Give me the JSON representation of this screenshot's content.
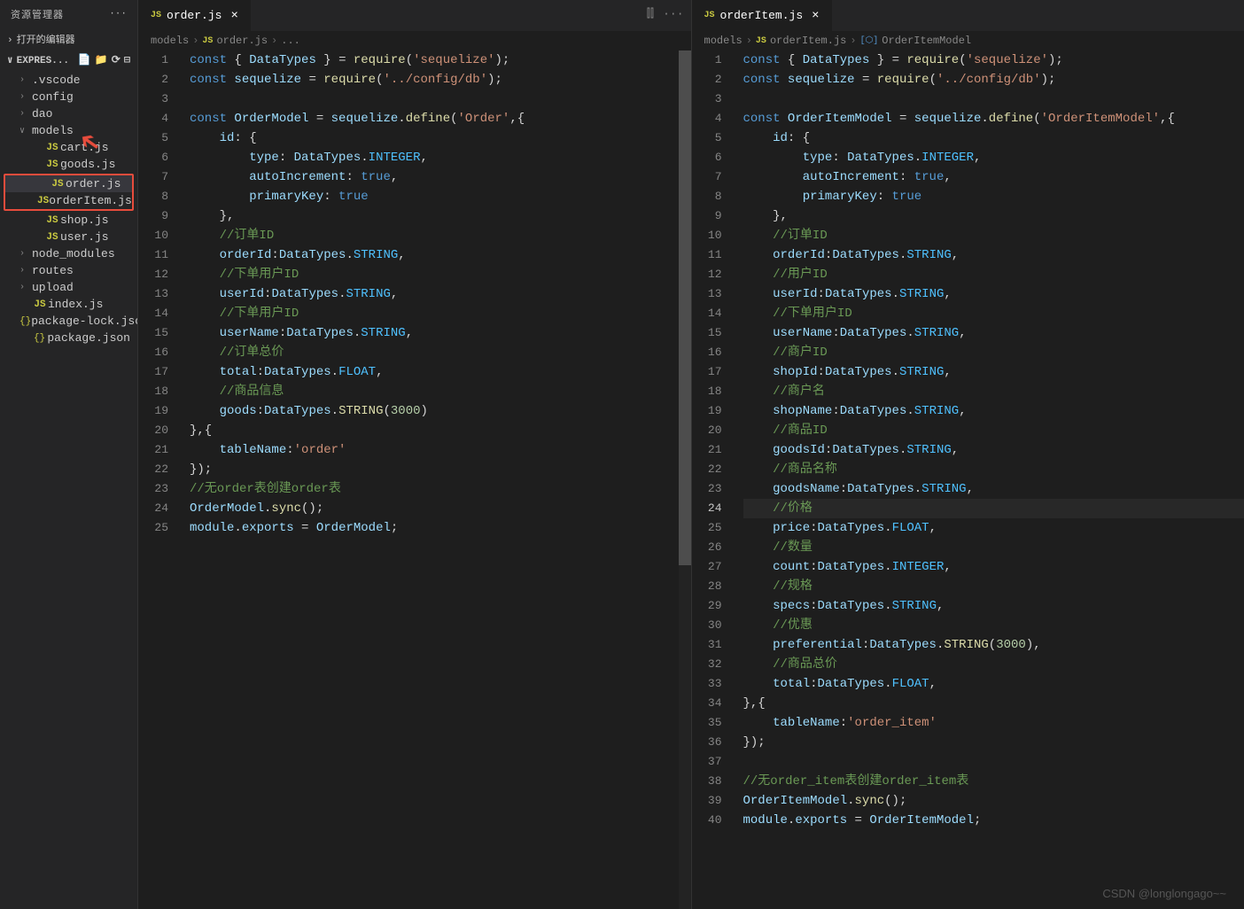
{
  "sidebar": {
    "title": "资源管理器",
    "open_editors": "打开的编辑器",
    "project": "EXPRES...",
    "items": [
      {
        "type": "folder",
        "name": ".vscode",
        "open": false,
        "indent": 1
      },
      {
        "type": "folder",
        "name": "config",
        "open": false,
        "indent": 1
      },
      {
        "type": "folder",
        "name": "dao",
        "open": false,
        "indent": 1
      },
      {
        "type": "folder",
        "name": "models",
        "open": true,
        "indent": 1
      },
      {
        "type": "js",
        "name": "cart.js",
        "indent": 2
      },
      {
        "type": "js",
        "name": "goods.js",
        "indent": 2
      },
      {
        "type": "js",
        "name": "order.js",
        "indent": 2,
        "active": true,
        "boxed": true
      },
      {
        "type": "js",
        "name": "orderItem.js",
        "indent": 2,
        "boxed": true
      },
      {
        "type": "js",
        "name": "shop.js",
        "indent": 2
      },
      {
        "type": "js",
        "name": "user.js",
        "indent": 2
      },
      {
        "type": "folder",
        "name": "node_modules",
        "open": false,
        "indent": 1
      },
      {
        "type": "folder",
        "name": "routes",
        "open": false,
        "indent": 1
      },
      {
        "type": "folder",
        "name": "upload",
        "open": false,
        "indent": 1
      },
      {
        "type": "js",
        "name": "index.js",
        "indent": 1
      },
      {
        "type": "json",
        "name": "package-lock.json",
        "indent": 1
      },
      {
        "type": "json",
        "name": "package.json",
        "indent": 1
      }
    ]
  },
  "editor_left": {
    "tab": "order.js",
    "breadcrumb": [
      "models",
      "order.js",
      "..."
    ],
    "lines": [
      "<span class='kw'>const</span> <span class='pun'>{ </span><span class='var'>DataTypes</span><span class='pun'> } = </span><span class='fn'>require</span><span class='pun'>(</span><span class='str'>'sequelize'</span><span class='pun'>);</span>",
      "<span class='kw'>const</span> <span class='var'>sequelize</span> <span class='pun'>= </span><span class='fn'>require</span><span class='pun'>(</span><span class='str'>'../config/db'</span><span class='pun'>);</span>",
      "",
      "<span class='kw'>const</span> <span class='var'>OrderModel</span> <span class='pun'>= </span><span class='var'>sequelize</span><span class='pun'>.</span><span class='fn'>define</span><span class='pun'>(</span><span class='str'>'Order'</span><span class='pun'>,{</span>",
      "    <span class='var'>id</span><span class='pun'>: {</span>",
      "        <span class='var'>type</span><span class='pun'>: </span><span class='var'>DataTypes</span><span class='pun'>.</span><span class='const'>INTEGER</span><span class='pun'>,</span>",
      "        <span class='var'>autoIncrement</span><span class='pun'>: </span><span class='kw'>true</span><span class='pun'>,</span>",
      "        <span class='var'>primaryKey</span><span class='pun'>: </span><span class='kw'>true</span>",
      "    <span class='pun'>},</span>",
      "    <span class='com'>//订单ID</span>",
      "    <span class='var'>orderId</span><span class='pun'>:</span><span class='var'>DataTypes</span><span class='pun'>.</span><span class='const'>STRING</span><span class='pun'>,</span>",
      "    <span class='com'>//下单用户ID</span>",
      "    <span class='var'>userId</span><span class='pun'>:</span><span class='var'>DataTypes</span><span class='pun'>.</span><span class='const'>STRING</span><span class='pun'>,</span>",
      "    <span class='com'>//下单用户ID</span>",
      "    <span class='var'>userName</span><span class='pun'>:</span><span class='var'>DataTypes</span><span class='pun'>.</span><span class='const'>STRING</span><span class='pun'>,</span>",
      "    <span class='com'>//订单总价</span>",
      "    <span class='var'>total</span><span class='pun'>:</span><span class='var'>DataTypes</span><span class='pun'>.</span><span class='const'>FLOAT</span><span class='pun'>,</span>",
      "    <span class='com'>//商品信息</span>",
      "    <span class='var'>goods</span><span class='pun'>:</span><span class='var'>DataTypes</span><span class='pun'>.</span><span class='fn'>STRING</span><span class='pun'>(</span><span class='num'>3000</span><span class='pun'>)</span>",
      "<span class='pun'>},{</span>",
      "    <span class='var'>tableName</span><span class='pun'>:</span><span class='str'>'order'</span>",
      "<span class='pun'>});</span>",
      "<span class='com'>//无order表创建order表</span>",
      "<span class='var'>OrderModel</span><span class='pun'>.</span><span class='fn'>sync</span><span class='pun'>();</span>",
      "<span class='var'>module</span><span class='pun'>.</span><span class='var'>exports</span> <span class='pun'>= </span><span class='var'>OrderModel</span><span class='pun'>;</span>"
    ]
  },
  "editor_right": {
    "tab": "orderItem.js",
    "breadcrumb": [
      "models",
      "orderItem.js",
      "OrderItemModel"
    ],
    "lines": [
      "<span class='kw'>const</span> <span class='pun'>{ </span><span class='var'>DataTypes</span><span class='pun'> } = </span><span class='fn'>require</span><span class='pun'>(</span><span class='str'>'sequelize'</span><span class='pun'>);</span>",
      "<span class='kw'>const</span> <span class='var'>sequelize</span> <span class='pun'>= </span><span class='fn'>require</span><span class='pun'>(</span><span class='str'>'../config/db'</span><span class='pun'>);</span>",
      "",
      "<span class='kw'>const</span> <span class='var'>OrderItemModel</span> <span class='pun'>= </span><span class='var'>sequelize</span><span class='pun'>.</span><span class='fn'>define</span><span class='pun'>(</span><span class='str'>'OrderItemModel'</span><span class='pun'>,{</span>",
      "    <span class='var'>id</span><span class='pun'>: {</span>",
      "        <span class='var'>type</span><span class='pun'>: </span><span class='var'>DataTypes</span><span class='pun'>.</span><span class='const'>INTEGER</span><span class='pun'>,</span>",
      "        <span class='var'>autoIncrement</span><span class='pun'>: </span><span class='kw'>true</span><span class='pun'>,</span>",
      "        <span class='var'>primaryKey</span><span class='pun'>: </span><span class='kw'>true</span>",
      "    <span class='pun'>},</span>",
      "    <span class='com'>//订单ID</span>",
      "    <span class='var'>orderId</span><span class='pun'>:</span><span class='var'>DataTypes</span><span class='pun'>.</span><span class='const'>STRING</span><span class='pun'>,</span>",
      "    <span class='com'>//用户ID</span>",
      "    <span class='var'>userId</span><span class='pun'>:</span><span class='var'>DataTypes</span><span class='pun'>.</span><span class='const'>STRING</span><span class='pun'>,</span>",
      "    <span class='com'>//下单用户ID</span>",
      "    <span class='var'>userName</span><span class='pun'>:</span><span class='var'>DataTypes</span><span class='pun'>.</span><span class='const'>STRING</span><span class='pun'>,</span>",
      "    <span class='com'>//商户ID</span>",
      "    <span class='var'>shopId</span><span class='pun'>:</span><span class='var'>DataTypes</span><span class='pun'>.</span><span class='const'>STRING</span><span class='pun'>,</span>",
      "    <span class='com'>//商户名</span>",
      "    <span class='var'>shopName</span><span class='pun'>:</span><span class='var'>DataTypes</span><span class='pun'>.</span><span class='const'>STRING</span><span class='pun'>,</span>",
      "    <span class='com'>//商品ID</span>",
      "    <span class='var'>goodsId</span><span class='pun'>:</span><span class='var'>DataTypes</span><span class='pun'>.</span><span class='const'>STRING</span><span class='pun'>,</span>",
      "    <span class='com'>//商品名称</span>",
      "    <span class='var'>goodsName</span><span class='pun'>:</span><span class='var'>DataTypes</span><span class='pun'>.</span><span class='const'>STRING</span><span class='pun'>,</span>",
      "    <span class='com'>//价格</span>",
      "    <span class='var'>price</span><span class='pun'>:</span><span class='var'>DataTypes</span><span class='pun'>.</span><span class='const'>FLOAT</span><span class='pun'>,</span>",
      "    <span class='com'>//数量</span>",
      "    <span class='var'>count</span><span class='pun'>:</span><span class='var'>DataTypes</span><span class='pun'>.</span><span class='const'>INTEGER</span><span class='pun'>,</span>",
      "    <span class='com'>//规格</span>",
      "    <span class='var'>specs</span><span class='pun'>:</span><span class='var'>DataTypes</span><span class='pun'>.</span><span class='const'>STRING</span><span class='pun'>,</span>",
      "    <span class='com'>//优惠</span>",
      "    <span class='var'>preferential</span><span class='pun'>:</span><span class='var'>DataTypes</span><span class='pun'>.</span><span class='fn'>STRING</span><span class='pun'>(</span><span class='num'>3000</span><span class='pun'>),</span>",
      "    <span class='com'>//商品总价</span>",
      "    <span class='var'>total</span><span class='pun'>:</span><span class='var'>DataTypes</span><span class='pun'>.</span><span class='const'>FLOAT</span><span class='pun'>,</span>",
      "<span class='pun'>},{</span>",
      "    <span class='var'>tableName</span><span class='pun'>:</span><span class='str'>'order_item'</span>",
      "<span class='pun'>});</span>",
      "",
      "<span class='com'>//无order_item表创建order_item表</span>",
      "<span class='var'>OrderItemModel</span><span class='pun'>.</span><span class='fn'>sync</span><span class='pun'>();</span>",
      "<span class='var'>module</span><span class='pun'>.</span><span class='var'>exports</span> <span class='pun'>= </span><span class='var'>OrderItemModel</span><span class='pun'>;</span>"
    ],
    "active_line": 24
  },
  "watermark": "CSDN @longlongago~~"
}
